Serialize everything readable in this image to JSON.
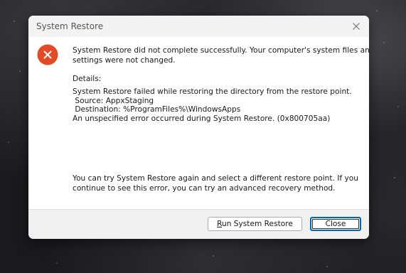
{
  "dialog": {
    "title": "System Restore",
    "message_line1": "System Restore did not complete successfully. Your computer's system files and",
    "message_line2": "settings were not changed.",
    "details_heading": "Details:",
    "details_lines": [
      "System Restore failed while restoring the directory from the restore point.",
      " Source: AppxStaging",
      " Destination: %ProgramFiles%\\WindowsApps",
      "An unspecified error occurred during System Restore. (0x800705aa)"
    ],
    "advice_line1": "You can try System Restore again and select a different restore point. If you",
    "advice_line2": "continue to see this error, you can try an advanced recovery method.",
    "error_icon": "error-x-circle-icon",
    "close_icon": "close-icon"
  },
  "buttons": {
    "run_restore_mnemonic": "R",
    "run_restore_rest": "un System Restore",
    "close": "Close"
  },
  "colors": {
    "error_red": "#e24b26",
    "focus_blue": "#0067c0"
  }
}
